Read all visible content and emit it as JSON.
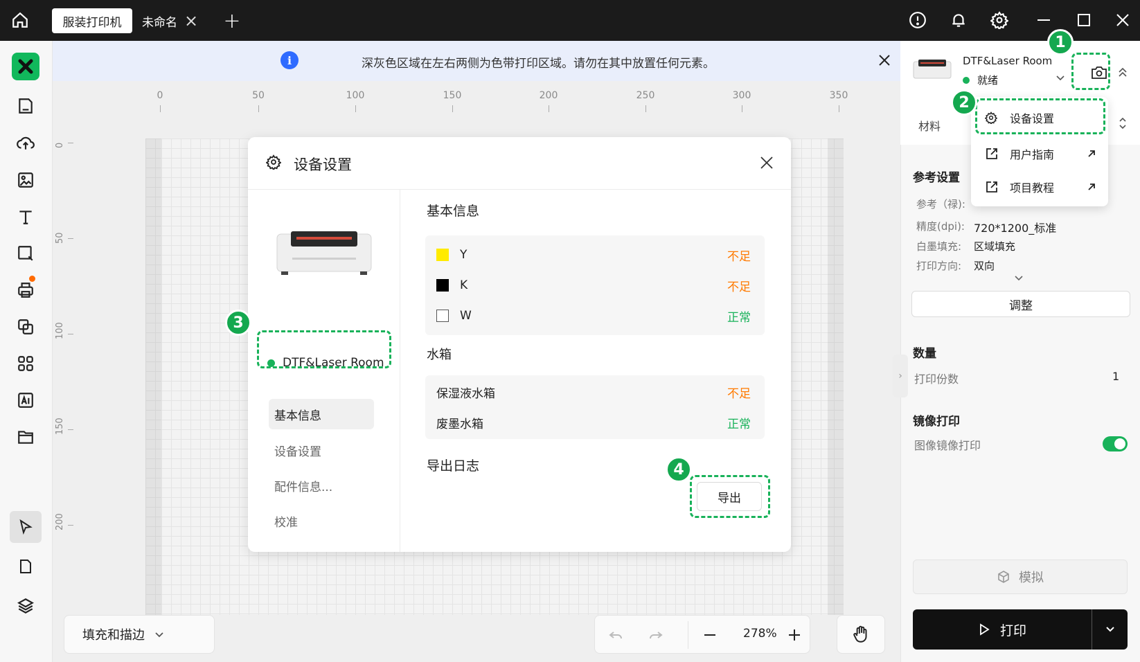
{
  "titlebar": {
    "tab_active": "服装打印机",
    "tab_untitled": "未命名"
  },
  "banner": {
    "text": "深灰色区域在左右两侧为色带打印区域。请勿在其中放置任何元素。",
    "info_icon_glyph": "i"
  },
  "ruler": {
    "h_labels": [
      "0",
      "50",
      "100",
      "150",
      "200",
      "250",
      "300",
      "350"
    ],
    "v_labels": [
      "0",
      "50",
      "100",
      "150",
      "200"
    ]
  },
  "bottom": {
    "fill_stroke": "填充和描边",
    "zoom": "278%"
  },
  "modal": {
    "title": "设备设置",
    "device_name": "DTF&Laser Room",
    "nav": [
      "基本信息",
      "设备设置",
      "配件信息...",
      "校准"
    ],
    "basic_info_title": "基本信息",
    "inks": [
      {
        "name": "Y",
        "status": "不足",
        "color": "#ffeb00"
      },
      {
        "name": "K",
        "status": "不足",
        "color": "#000000"
      },
      {
        "name": "W",
        "status": "正常",
        "color": "#ffffff"
      }
    ],
    "tank_title": "水箱",
    "tanks": [
      {
        "name": "保湿液水箱",
        "status": "不足"
      },
      {
        "name": "废墨水箱",
        "status": "正常"
      }
    ],
    "export_log_title": "导出日志",
    "export_button": "导出"
  },
  "badges": [
    "1",
    "2",
    "3",
    "4"
  ],
  "right_panel": {
    "device_name": "DTF&Laser Room",
    "status": "就绪",
    "material_label": "材料",
    "ref_settings_title": "参考设置",
    "ref_label": "参考（禄):",
    "precision_label": "精度(dpi):",
    "precision_value": "720*1200_标准",
    "white_fill_label": "白墨填充:",
    "white_fill_value": "区域填充",
    "print_dir_label": "打印方向:",
    "print_dir_value": "双向",
    "adjust_button": "调整",
    "quantity_title": "数量",
    "copies_label": "打印份数",
    "copies_value": "1",
    "mirror_title": "镜像打印",
    "mirror_label": "图像镜像打印",
    "mirror_on": true,
    "simulate_button": "模拟",
    "print_button": "打印"
  },
  "dropdown": {
    "items": [
      "设备设置",
      "用户指南",
      "项目教程"
    ]
  },
  "colors": {
    "accent_green": "#19b25a",
    "warn_orange": "#ff7a00",
    "titlebar": "#1b1b1b"
  }
}
